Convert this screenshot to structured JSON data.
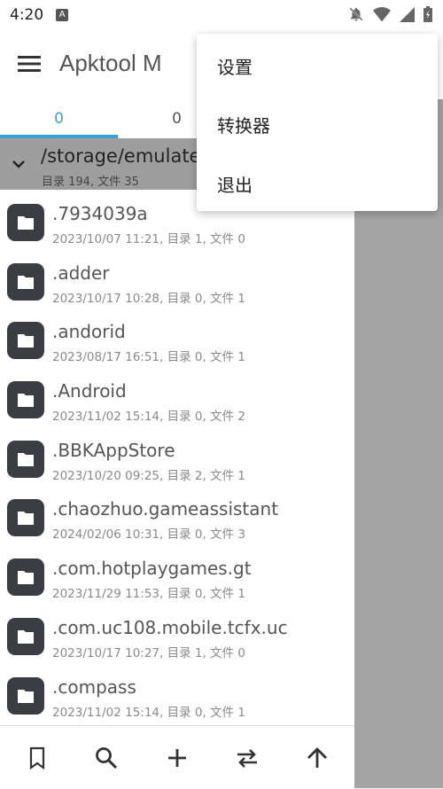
{
  "status_bar": {
    "time": "4:20",
    "a_badge": "A"
  },
  "app_bar": {
    "title": "Apktool M"
  },
  "tabs": [
    {
      "label": "0"
    },
    {
      "label": "0"
    }
  ],
  "path_header": {
    "path": "/storage/emulated",
    "summary": "目录 194, 文件 35"
  },
  "files": [
    {
      "name": ".7934039a",
      "meta": "2023/10/07 11:21, 目录 1, 文件 0"
    },
    {
      "name": ".adder",
      "meta": "2023/10/17 10:28, 目录 0, 文件 1"
    },
    {
      "name": ".andorid",
      "meta": "2023/08/17 16:51, 目录 0, 文件 1"
    },
    {
      "name": ".Android",
      "meta": "2023/11/02 15:14, 目录 0, 文件 2"
    },
    {
      "name": ".BBKAppStore",
      "meta": "2023/10/20 09:25, 目录 2, 文件 1"
    },
    {
      "name": ".chaozhuo.gameassistant",
      "meta": "2024/02/06 10:31, 目录 0, 文件 3"
    },
    {
      "name": ".com.hotplaygames.gt",
      "meta": "2023/11/29 11:53, 目录 0, 文件 1"
    },
    {
      "name": ".com.uc108.mobile.tcfx.uc",
      "meta": "2023/10/17 10:27, 目录 1, 文件 0"
    },
    {
      "name": ".compass",
      "meta": "2023/11/02 15:14, 目录 0, 文件 1"
    }
  ],
  "popup_menu": {
    "items": [
      {
        "label": "设置"
      },
      {
        "label": "转换器"
      },
      {
        "label": "退出"
      }
    ]
  },
  "colors": {
    "accent": "#3aa0d8",
    "folder": "#3b3d42",
    "header_bg": "#9e9e9e",
    "scrim": "#a4a4a4"
  },
  "icons": {
    "bottom_bar": [
      "bookmark-icon",
      "search-icon",
      "add-icon",
      "swap-icon",
      "arrow-up-icon"
    ],
    "status": [
      "notifications-off-icon",
      "wifi-icon",
      "signal-icon",
      "battery-icon"
    ]
  }
}
